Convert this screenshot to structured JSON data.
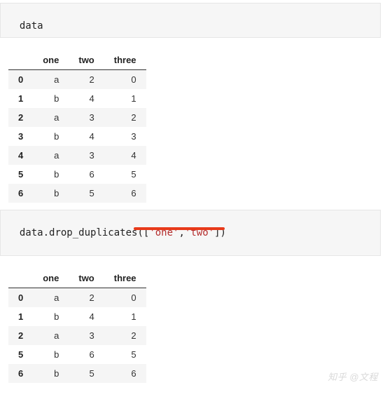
{
  "cell1": {
    "code": "data"
  },
  "table1": {
    "columns": [
      "one",
      "two",
      "three"
    ],
    "rows": [
      {
        "idx": "0",
        "one": "a",
        "two": "2",
        "three": "0"
      },
      {
        "idx": "1",
        "one": "b",
        "two": "4",
        "three": "1"
      },
      {
        "idx": "2",
        "one": "a",
        "two": "3",
        "three": "2"
      },
      {
        "idx": "3",
        "one": "b",
        "two": "4",
        "three": "3"
      },
      {
        "idx": "4",
        "one": "a",
        "two": "3",
        "three": "4"
      },
      {
        "idx": "5",
        "one": "b",
        "two": "6",
        "three": "5"
      },
      {
        "idx": "6",
        "one": "b",
        "two": "5",
        "three": "6"
      }
    ]
  },
  "cell2": {
    "var": "data",
    "method": "drop_duplicates",
    "args": [
      "'one'",
      "'two'"
    ]
  },
  "table2": {
    "columns": [
      "one",
      "two",
      "three"
    ],
    "rows": [
      {
        "idx": "0",
        "one": "a",
        "two": "2",
        "three": "0"
      },
      {
        "idx": "1",
        "one": "b",
        "two": "4",
        "three": "1"
      },
      {
        "idx": "2",
        "one": "a",
        "two": "3",
        "three": "2"
      },
      {
        "idx": "5",
        "one": "b",
        "two": "6",
        "three": "5"
      },
      {
        "idx": "6",
        "one": "b",
        "two": "5",
        "three": "6"
      }
    ]
  },
  "watermark": "知乎 @文程"
}
